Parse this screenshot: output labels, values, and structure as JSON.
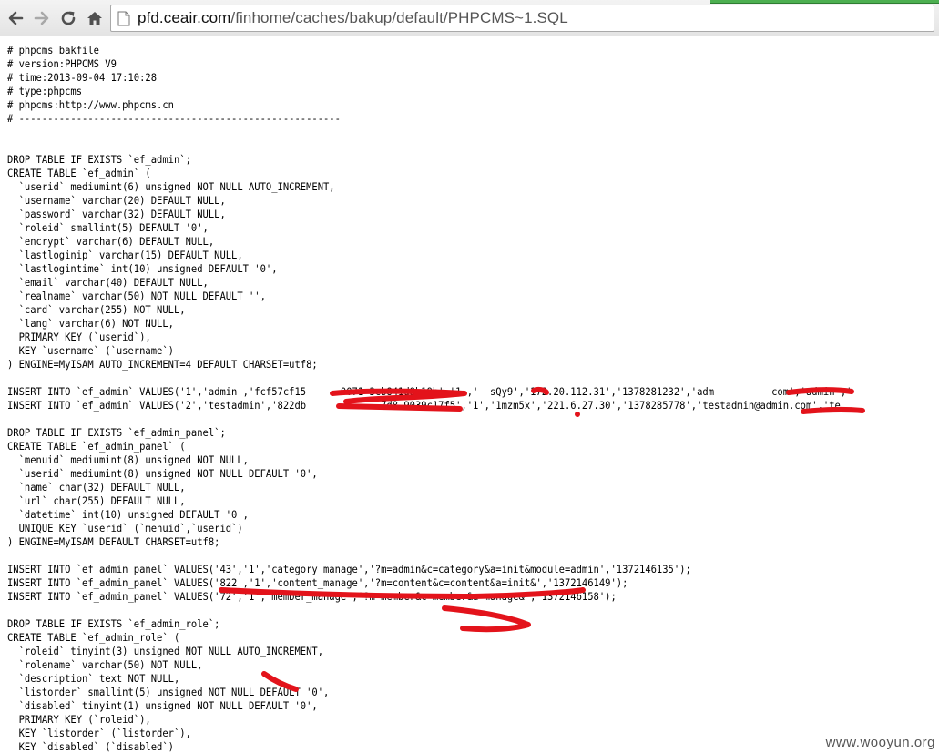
{
  "browser": {
    "url_host": "pfd.ceair.com",
    "url_path": "/finhome/caches/bakup/default/PHPCMS~1.SQL",
    "colors": {
      "annotation_red": "#e3131b",
      "tab_accent": "#4caf50"
    }
  },
  "document": {
    "lines": [
      "# phpcms bakfile",
      "# version:PHPCMS V9",
      "# time:2013-09-04 17:10:28",
      "# type:phpcms",
      "# phpcms:http://www.phpcms.cn",
      "# --------------------------------------------------------",
      "",
      "",
      "DROP TABLE IF EXISTS `ef_admin`;",
      "CREATE TABLE `ef_admin` (",
      "  `userid` mediumint(6) unsigned NOT NULL AUTO_INCREMENT,",
      "  `username` varchar(20) DEFAULT NULL,",
      "  `password` varchar(32) DEFAULT NULL,",
      "  `roleid` smallint(5) DEFAULT '0',",
      "  `encrypt` varchar(6) DEFAULT NULL,",
      "  `lastloginip` varchar(15) DEFAULT NULL,",
      "  `lastlogintime` int(10) unsigned DEFAULT '0',",
      "  `email` varchar(40) DEFAULT NULL,",
      "  `realname` varchar(50) NOT NULL DEFAULT '',",
      "  `card` varchar(255) NOT NULL,",
      "  `lang` varchar(6) NOT NULL,",
      "  PRIMARY KEY (`userid`),",
      "  KEY `username` (`username`)",
      ") ENGINE=MyISAM AUTO_INCREMENT=4 DEFAULT CHARSET=utf8;",
      "",
      "INSERT INTO `ef_admin` VALUES('1','admin','fcf57cf15      0071 3cb841d8b19b','1','  sQy9','172.20.112.31','1378281232','adm          com','admin','",
      "INSERT INTO `ef_admin` VALUES('2','testadmin','822db             7d8 9039c17f5','1','1mzm5x','221.6.27.30','1378285778','testadmin@admin.com','te",
      "",
      "DROP TABLE IF EXISTS `ef_admin_panel`;",
      "CREATE TABLE `ef_admin_panel` (",
      "  `menuid` mediumint(8) unsigned NOT NULL,",
      "  `userid` mediumint(8) unsigned NOT NULL DEFAULT '0',",
      "  `name` char(32) DEFAULT NULL,",
      "  `url` char(255) DEFAULT NULL,",
      "  `datetime` int(10) unsigned DEFAULT '0',",
      "  UNIQUE KEY `userid` (`menuid`,`userid`)",
      ") ENGINE=MyISAM DEFAULT CHARSET=utf8;",
      "",
      "INSERT INTO `ef_admin_panel` VALUES('43','1','category_manage','?m=admin&c=category&a=init&module=admin','1372146135');",
      "INSERT INTO `ef_admin_panel` VALUES('822','1','content_manage','?m=content&c=content&a=init&','1372146149');",
      "INSERT INTO `ef_admin_panel` VALUES('72','1','member_manage','?m=member&c=member&a=manage&','1372146158');",
      "",
      "DROP TABLE IF EXISTS `ef_admin_role`;",
      "CREATE TABLE `ef_admin_role` (",
      "  `roleid` tinyint(3) unsigned NOT NULL AUTO_INCREMENT,",
      "  `rolename` varchar(50) NOT NULL,",
      "  `description` text NOT NULL,",
      "  `listorder` smallint(5) unsigned NOT NULL DEFAULT '0',",
      "  `disabled` tinyint(1) unsigned NOT NULL DEFAULT '0',",
      "  PRIMARY KEY (`roleid`),",
      "  KEY `listorder` (`listorder`),",
      "  KEY `disabled` (`disabled`)"
    ]
  },
  "watermark": "www.wooyun.org"
}
